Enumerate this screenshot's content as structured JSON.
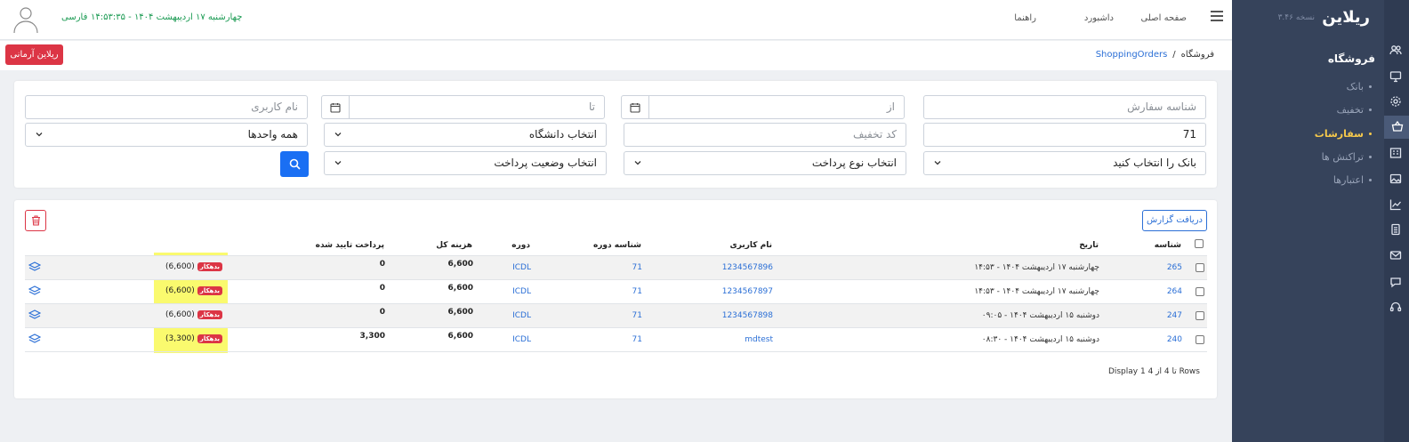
{
  "colors": {
    "sidebar": "#36435b",
    "rail": "#2f3b52",
    "active": "#f6c94b",
    "primary": "#1a6ff3",
    "danger": "#dc3545",
    "highlight": "#fafa6e",
    "clock": "#1a9a52"
  },
  "sidebar": {
    "brand": "ریلاین",
    "version": "نسخه ۳.۴۶",
    "section_title": "فروشگاه",
    "items": [
      {
        "label": "بانک",
        "active": false
      },
      {
        "label": "تخفیف",
        "active": false
      },
      {
        "label": "سفارشات",
        "active": true
      },
      {
        "label": "تراکنش ها",
        "active": false
      },
      {
        "label": "اعتبارها",
        "active": false
      }
    ],
    "rail_icons": [
      "users-icon",
      "monitor-icon",
      "gear-icon",
      "basket-icon",
      "building-icon",
      "image-icon",
      "chart-icon",
      "document-icon",
      "mail-icon",
      "chat-icon",
      "headset-icon"
    ]
  },
  "header": {
    "nav": [
      "صفحه اصلی",
      "داشبورد",
      "راهنما"
    ],
    "language": "فارسی",
    "datetime": "چهارشنبه ۱۷ اردیبهشت ۱۴۰۴ - ۱۴:۵۳:۳۵"
  },
  "breadcrumb": {
    "root": "فروشگاه",
    "separator": "/",
    "current": "ShoppingOrders"
  },
  "brand_button": "ریلاین آرمانی",
  "filters": {
    "order_id_placeholder": "شناسه سفارش",
    "from_placeholder": "از",
    "to_placeholder": "تا",
    "username_placeholder": "نام کاربری",
    "course_id_value": "71",
    "discount_placeholder": "کد تخفیف",
    "university_select": "انتخاب دانشگاه",
    "units_select": "همه واحدها",
    "bank_select": "بانک را انتخاب کنید",
    "payment_type_select": "انتخاب نوع پرداخت",
    "payment_status_select": "انتخاب وضعیت پرداخت"
  },
  "table": {
    "report_button": "دریافت گزارش",
    "headers": {
      "id": "شناسه",
      "date": "تاریخ",
      "username": "نام کاربری",
      "course_id": "شناسه دوره",
      "course": "دوره",
      "total": "هزینه کل",
      "paid": "پرداخت تایید شده"
    },
    "rows": [
      {
        "id": "265",
        "date": "چهارشنبه ۱۷ اردیبهشت ۱۴۰۴ - ۱۴:۵۳",
        "username": "1234567896",
        "course_id": "71",
        "course": "ICDL",
        "total": "6,600",
        "paid": "0",
        "debt_amount": "(6,600)",
        "debt_badge": "بدهکار"
      },
      {
        "id": "264",
        "date": "چهارشنبه ۱۷ اردیبهشت ۱۴۰۴ - ۱۴:۵۳",
        "username": "1234567897",
        "course_id": "71",
        "course": "ICDL",
        "total": "6,600",
        "paid": "0",
        "debt_amount": "(6,600)",
        "debt_badge": "بدهکار"
      },
      {
        "id": "247",
        "date": "دوشنبه ۱۵ اردیبهشت ۱۴۰۴ - ۰۹:۰۵",
        "username": "1234567898",
        "course_id": "71",
        "course": "ICDL",
        "total": "6,600",
        "paid": "0",
        "debt_amount": "(6,600)",
        "debt_badge": "بدهکار"
      },
      {
        "id": "240",
        "date": "دوشنبه ۱۵ اردیبهشت ۱۴۰۴ - ۰۸:۳۰",
        "username": "mdtest",
        "course_id": "71",
        "course": "ICDL",
        "total": "6,600",
        "paid": "3,300",
        "debt_amount": "(3,300)",
        "debt_badge": "بدهکار"
      }
    ],
    "pagination": "Display 1 تا 4 از 4 Rows"
  }
}
